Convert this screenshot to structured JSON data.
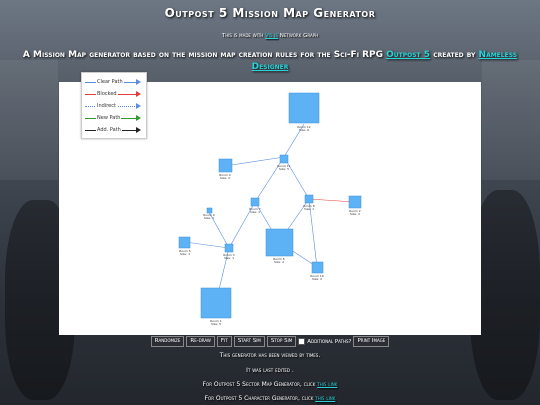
{
  "header": {
    "title": "Outpost 5 Mission Map Generator",
    "made_with_prefix": "This is made with ",
    "made_with_link": "Vis.js",
    "made_with_suffix": " Network Graph",
    "tagline_part1": "A Mission Map generator based on the mission map creation rules for the Sci-Fi RPG ",
    "tagline_link1": "Outpost 5",
    "tagline_part2": " created by ",
    "tagline_link2": "Nameless Designer"
  },
  "legend": [
    {
      "label": "Clear Path",
      "color": "#5a8dde",
      "dashed": false
    },
    {
      "label": "Blocked",
      "color": "#e23b3b",
      "dashed": false
    },
    {
      "label": "Indirect",
      "color": "#5a8dde",
      "dashed": true
    },
    {
      "label": "New Path",
      "color": "#2f9a2f",
      "dashed": false
    },
    {
      "label": "Add. Path",
      "color": "#222222",
      "dashed": false
    }
  ],
  "graph": {
    "node_color": "#5db2f5",
    "node_border": "#3f8ed8",
    "nodes": [
      {
        "id": "n1",
        "line1": "Room 1",
        "line2": "Size: 5"
      },
      {
        "id": "n2",
        "line1": "Room 2",
        "line2": "Size: 2"
      },
      {
        "id": "n3",
        "line1": "Room 3",
        "line2": "Size: 1"
      },
      {
        "id": "n4",
        "line1": "Room 4",
        "line2": "Size: 2"
      },
      {
        "id": "n5",
        "line1": "Room 5",
        "line2": "Size: 1"
      },
      {
        "id": "n6",
        "line1": "Room 6",
        "line2": "Size: 2"
      },
      {
        "id": "n7",
        "line1": "Room 7",
        "line2": "Size: 1"
      },
      {
        "id": "n8",
        "line1": "Room 8",
        "line2": "Size: 1"
      },
      {
        "id": "n9",
        "line1": "Room 9",
        "line2": "Size: 1"
      },
      {
        "id": "n10",
        "line1": "Room 10",
        "line2": "Size: 2"
      },
      {
        "id": "n11",
        "line1": "Room 11",
        "line2": "Size: 5"
      },
      {
        "id": "n12",
        "line1": "Room 12",
        "line2": "Size: 6"
      }
    ]
  },
  "toolbar": {
    "randomize": "Randomize",
    "redraw": "Re-draw",
    "fit": "Fit",
    "start_sim": "Start Sim",
    "stop_sim": "Stop Sim",
    "additional_paths": "Additional Paths?",
    "print_image": "Print Image"
  },
  "footer": {
    "views": "This generator has been viewed by times.",
    "edited": "It was last edited .",
    "sector_text": "For Outpost 5 Sector Map Generator, click ",
    "sector_link": "this link",
    "character_text": "For Outpost 5 Character Generator, click ",
    "character_link": "this link"
  }
}
